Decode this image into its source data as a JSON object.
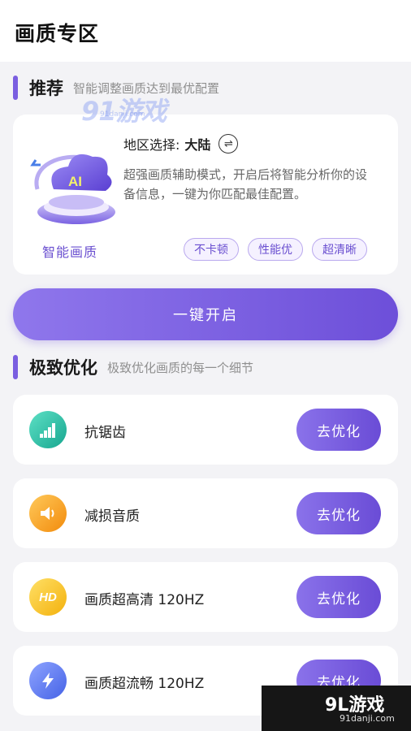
{
  "page": {
    "title": "画质专区"
  },
  "recommend": {
    "title": "推荐",
    "subtitle": "智能调整画质达到最优配置",
    "ai_badge": "AI",
    "ai_caption": "智能画质",
    "region_label": "地区选择:",
    "region_value": "大陆",
    "description": "超强画质辅助模式，开启后将智能分析你的设备信息，一键为你匹配最佳配置。",
    "tags": [
      "不卡顿",
      "性能优",
      "超清晰"
    ],
    "start_button": "一键开启"
  },
  "extreme": {
    "title": "极致优化",
    "subtitle": "极致优化画质的每一个细节",
    "items": [
      {
        "label": "抗锯齿",
        "button": "去优化",
        "icon": "antialias-icon",
        "color": "#22bfa6"
      },
      {
        "label": "减损音质",
        "button": "去优化",
        "icon": "speaker-icon",
        "color": "#f7a21b"
      },
      {
        "label": "画质超高清 120HZ",
        "button": "去优化",
        "icon": "hd-icon",
        "icon_text": "HD",
        "color": "#f6c21c"
      },
      {
        "label": "画质超流畅 120HZ",
        "button": "去优化",
        "icon": "lightning-icon",
        "color": "#5a74f0"
      }
    ]
  },
  "watermark": {
    "top_text": "91游戏",
    "top_sub": "91danji.com",
    "corner_text": "9L游戏",
    "corner_sub": "91danji.com"
  },
  "colors": {
    "accent": "#7a5ee0",
    "background": "#f3f3f6",
    "card": "#ffffff"
  }
}
